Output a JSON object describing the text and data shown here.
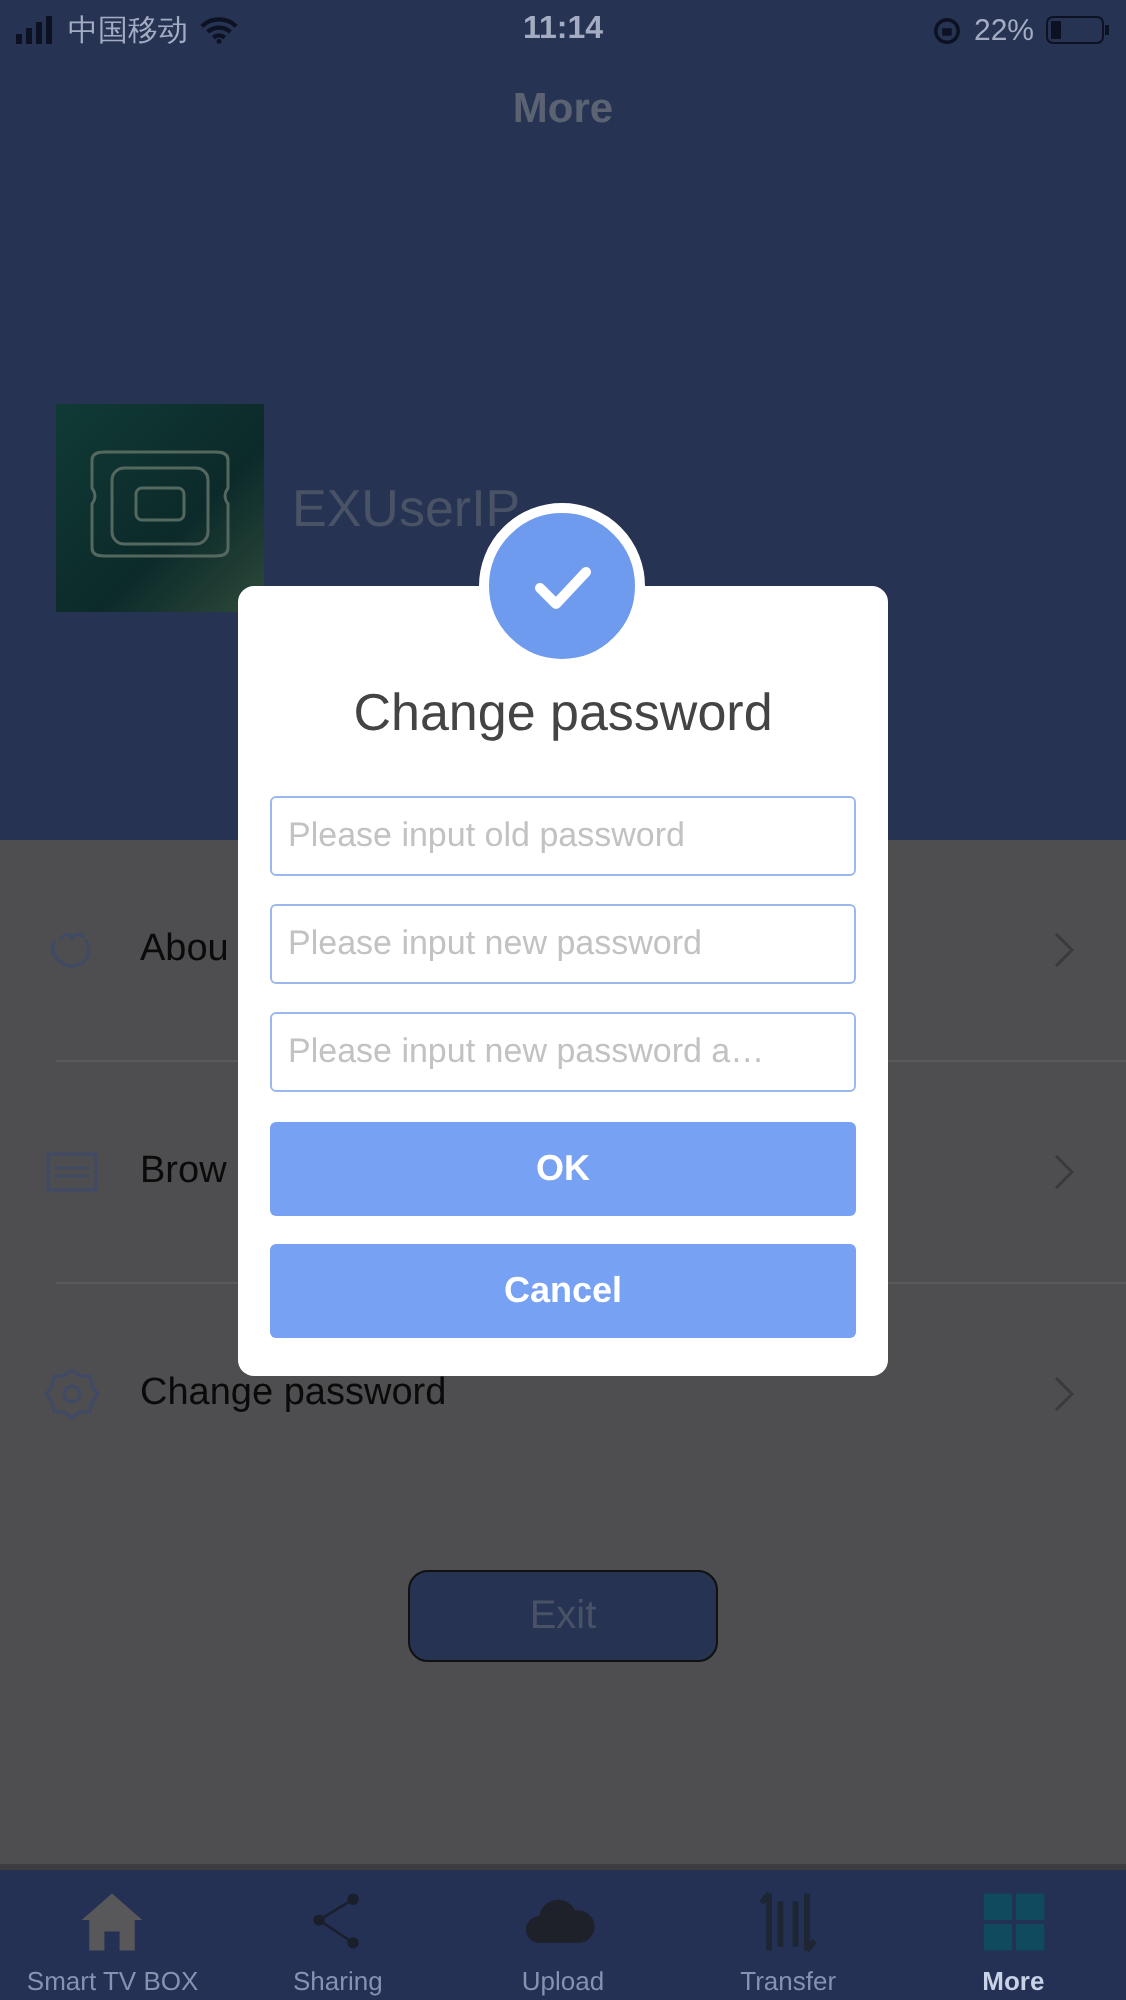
{
  "status_bar": {
    "carrier": "中国移动",
    "time": "11:14",
    "battery": "22%"
  },
  "nav": {
    "title": "More"
  },
  "profile": {
    "username": "EXUserIP"
  },
  "menu": [
    {
      "label": "Abou"
    },
    {
      "label": "Brow"
    },
    {
      "label": "Change password"
    }
  ],
  "exit_button": "Exit",
  "tab_bar": [
    {
      "label": "Smart TV BOX",
      "selected": false
    },
    {
      "label": "Sharing",
      "selected": false
    },
    {
      "label": "Upload",
      "selected": false
    },
    {
      "label": "Transfer",
      "selected": false
    },
    {
      "label": "More",
      "selected": true
    }
  ],
  "dialog": {
    "title": "Change password",
    "fields": [
      {
        "placeholder": "Please input old password"
      },
      {
        "placeholder": "Please input new password"
      },
      {
        "placeholder": "Please input new password a…"
      }
    ],
    "buttons": [
      "OK",
      "Cancel"
    ]
  }
}
